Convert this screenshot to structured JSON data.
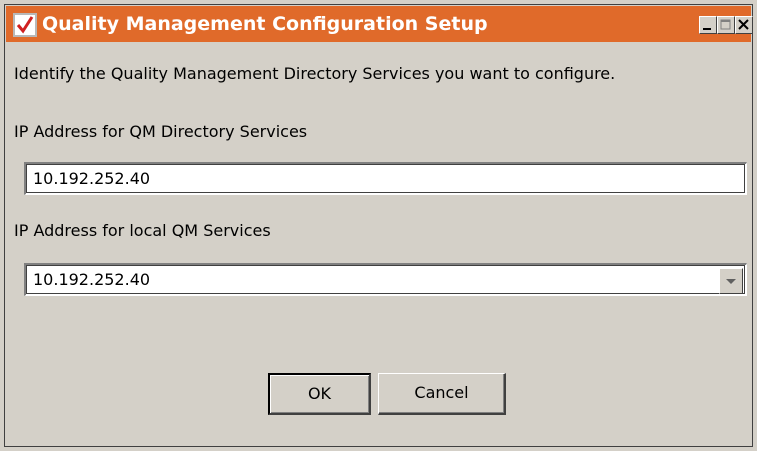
{
  "window": {
    "title": "Quality Management Configuration Setup",
    "title_bar_color": "#e06a2a",
    "controls": {
      "minimize_icon": "minimize-icon",
      "maximize_icon": "maximize-icon",
      "close_icon": "close-icon"
    }
  },
  "form": {
    "instruction": "Identify the Quality Management Directory Services you want to configure.",
    "directory_services": {
      "label": "IP Address for QM Directory Services",
      "value": "10.192.252.40"
    },
    "local_services": {
      "label": "IP Address for local QM Services",
      "selected": "10.192.252.40"
    }
  },
  "buttons": {
    "ok": "OK",
    "cancel": "Cancel"
  }
}
